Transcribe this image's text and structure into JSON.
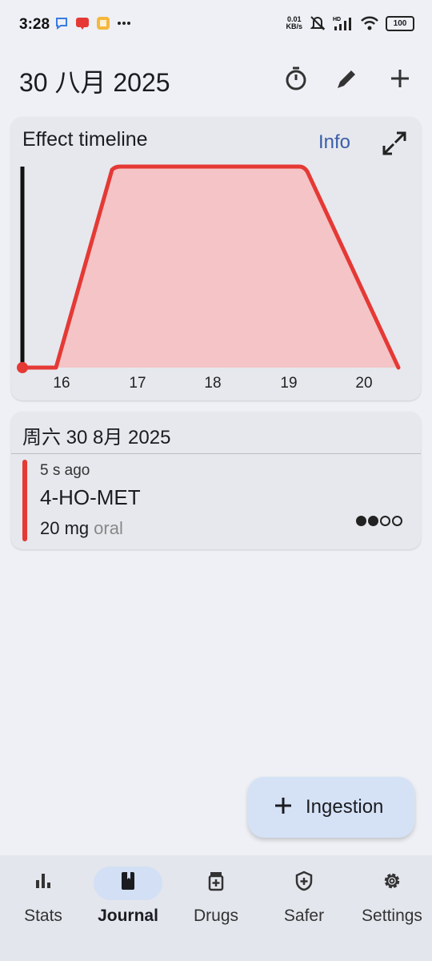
{
  "status_bar": {
    "time": "3:28",
    "net_speed_value": "0.01",
    "net_speed_unit": "KB/s",
    "battery": "100",
    "icons": [
      "chat-bubble-icon",
      "red-app-icon",
      "yellow-app-icon",
      "more-dots-icon",
      "mute-icon",
      "hd-icon",
      "signal-icon",
      "wifi-icon",
      "battery-icon"
    ]
  },
  "header": {
    "title": "30 八月 2025",
    "actions": [
      "timer-icon",
      "edit-icon",
      "add-icon"
    ]
  },
  "timeline": {
    "title": "Effect timeline",
    "info_label": "Info",
    "expand_icon": "expand-icon",
    "x_ticks": [
      "16",
      "17",
      "18",
      "19",
      "20"
    ],
    "curve_color": "#e53935",
    "fill_color": "#f4c4c6",
    "now_marker_color": "#111111"
  },
  "journal": {
    "date": "周六 30 8月 2025",
    "ingestion": {
      "time_ago": "5 s ago",
      "substance": "4-HO-MET",
      "dose": "20 mg",
      "route": "oral",
      "color": "#e53935",
      "intensity_level": 2,
      "intensity_max": 4
    }
  },
  "fab": {
    "label": "Ingestion",
    "icon": "add-icon"
  },
  "bottom_nav": {
    "items": [
      {
        "label": "Stats",
        "icon": "bar-chart-icon",
        "active": false
      },
      {
        "label": "Journal",
        "icon": "book-icon",
        "active": true
      },
      {
        "label": "Drugs",
        "icon": "medicine-icon",
        "active": false
      },
      {
        "label": "Safer",
        "icon": "shield-plus-icon",
        "active": false
      },
      {
        "label": "Settings",
        "icon": "gear-icon",
        "active": false
      }
    ]
  }
}
